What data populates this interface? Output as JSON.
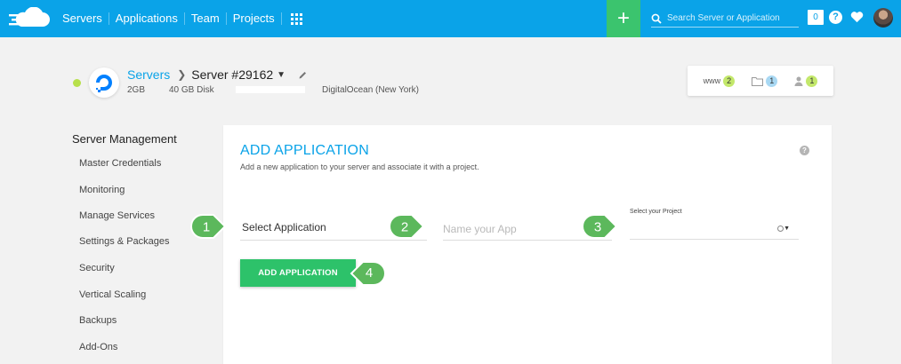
{
  "topbar": {
    "nav": [
      "Servers",
      "Applications",
      "Team",
      "Projects"
    ],
    "search_placeholder": "Search Server or Application",
    "notification_count": "0",
    "help": "?",
    "colors": {
      "bar": "#0aa3e8",
      "add": "#3bc46e"
    }
  },
  "server": {
    "breadcrumb_link": "Servers",
    "name": "Server #29162",
    "ram": "2GB",
    "disk": "40 GB Disk",
    "provider": "DigitalOcean (New York)",
    "stats": {
      "www_label": "www",
      "www_count": "2",
      "folder_count": "1",
      "user_count": "1"
    }
  },
  "sidebar": {
    "title": "Server Management",
    "items": [
      "Master Credentials",
      "Monitoring",
      "Manage Services",
      "Settings & Packages",
      "Security",
      "Vertical Scaling",
      "Backups",
      "Add-Ons"
    ]
  },
  "main": {
    "title": "ADD APPLICATION",
    "subtitle": "Add a new application to your server and associate it with a project.",
    "select_application": "Select Application",
    "name_placeholder": "Name your App",
    "project_label": "Select your Project",
    "button": "ADD APPLICATION"
  },
  "markers": [
    "1",
    "2",
    "3",
    "4"
  ],
  "icons": [
    "cloud-logo",
    "grid-icon",
    "plus-icon",
    "search-icon",
    "help-icon",
    "heart-icon",
    "avatar",
    "digitalocean-logo",
    "pencil-icon",
    "folder-icon",
    "user-icon"
  ]
}
